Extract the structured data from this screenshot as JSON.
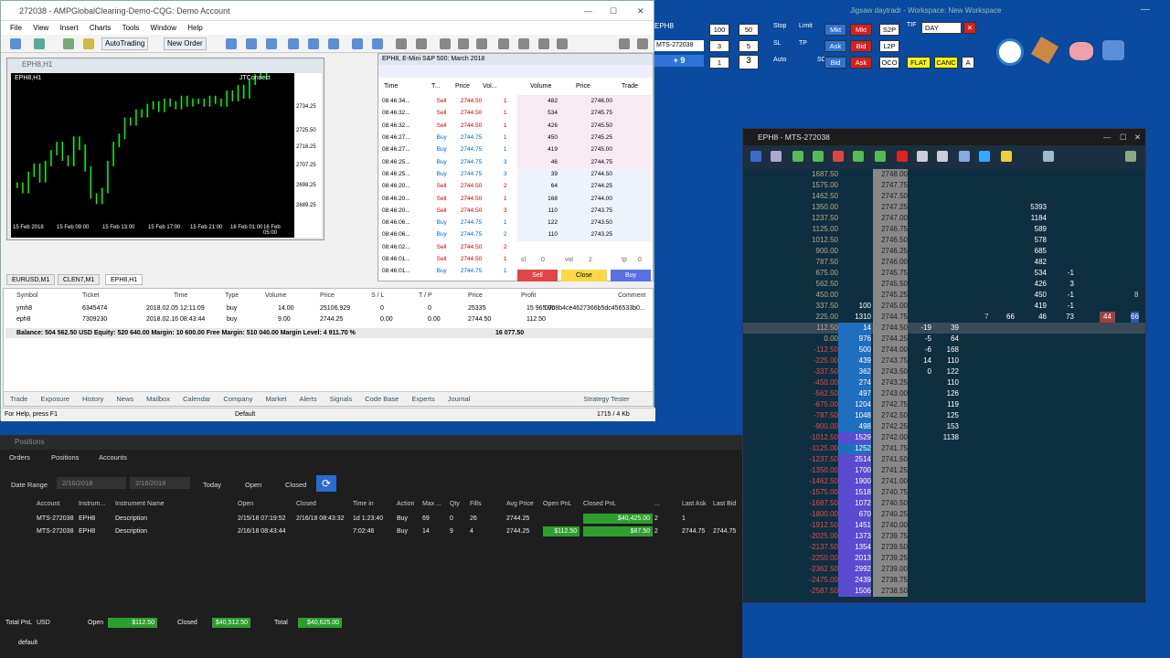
{
  "mt": {
    "title": "272038 - AMPGlobalClearing-Demo-CQG: Demo Account",
    "menu": [
      "File",
      "View",
      "Insert",
      "Charts",
      "Tools",
      "Window",
      "Help"
    ],
    "autotrading": "AutoTrading",
    "new_order": "New Order",
    "chart": {
      "title": "EPH8,H1",
      "symbol_label": "ЕРН8,Н1",
      "connector": "JTConnect",
      "y_ticks": [
        "2734.25",
        "2725.50",
        "2716.25",
        "2707.25",
        "2698.25",
        "2689.25"
      ],
      "x_ticks": [
        "15 Feb 2018",
        "15 Feb 09:00",
        "15 Feb 13:00",
        "15 Feb 17:00",
        "15 Feb 21:00",
        "16 Feb 01:00",
        "16 Feb 05:00"
      ]
    },
    "dom": {
      "title": "EPH8, E-Mini S&P 500: March 2018",
      "headers": [
        "Time",
        "T...",
        "Price",
        "Vol...",
        "Volume",
        "Price",
        "Trade"
      ],
      "ticks": [
        [
          "08:46:34...",
          "Sell",
          "2744.50",
          "1"
        ],
        [
          "08:46:32...",
          "Sell",
          "2744.50",
          "1"
        ],
        [
          "08:46:32...",
          "Sell",
          "2744.50",
          "1"
        ],
        [
          "08:46:27...",
          "Buy",
          "2744.75",
          "1"
        ],
        [
          "08:46:27...",
          "Buy",
          "2744.75",
          "1"
        ],
        [
          "08:46:25...",
          "Buy",
          "2744.75",
          "3"
        ],
        [
          "08:46:25...",
          "Buy",
          "2744.75",
          "3"
        ],
        [
          "08:46:20...",
          "Sell",
          "2744.50",
          "2"
        ],
        [
          "08:46:20...",
          "Sell",
          "2744.50",
          "1"
        ],
        [
          "08:46:20...",
          "Sell",
          "2744.50",
          "3"
        ],
        [
          "08:46:06...",
          "Buy",
          "2744.75",
          "1"
        ],
        [
          "08:46:06...",
          "Buy",
          "2744.75",
          "2"
        ],
        [
          "08:46:02...",
          "Sell",
          "2744.50",
          "2"
        ],
        [
          "08:46:01...",
          "Sell",
          "2744.50",
          "1"
        ],
        [
          "08:46:01...",
          "Buy",
          "2744.75",
          "1"
        ]
      ],
      "book": [
        [
          "482",
          "2746.00"
        ],
        [
          "534",
          "2745.75"
        ],
        [
          "426",
          "2745.50"
        ],
        [
          "450",
          "2745.25"
        ],
        [
          "419",
          "2745.00"
        ],
        [
          "46",
          "2744.75"
        ],
        [
          "39",
          "2744.50"
        ],
        [
          "64",
          "2744.25"
        ],
        [
          "168",
          "2744.00"
        ],
        [
          "110",
          "2743.75"
        ],
        [
          "122",
          "2743.50"
        ],
        [
          "110",
          "2743.25"
        ]
      ],
      "sl": "sl",
      "sl_val": "0",
      "vol": "vol",
      "vol_val": "2",
      "tp": "tp",
      "tp_val": "0",
      "sell": "Sell",
      "close": "Close",
      "buy": "Buy"
    },
    "symbol_tabs": [
      "EURUSD,M1",
      "CLEN7,M1",
      "EPH8,H1"
    ],
    "terminal": {
      "headers": [
        "Symbol",
        "Ticket",
        "Time",
        "Type",
        "Volume",
        "Price",
        "S / L",
        "T / P",
        "Price",
        "Profit",
        "Comment"
      ],
      "rows": [
        [
          "ymh8",
          "6345474",
          "2018.02.05 12:11:09",
          "buy",
          "14.00",
          "25106.929",
          "0",
          "0",
          "25335",
          "15 965.00",
          "07c8b4ce4627366b5dc456533b0..."
        ],
        [
          "eph8",
          "7309230",
          "2018.02.16 08:43:44",
          "buy",
          "9.00",
          "2744.25",
          "0.00",
          "0.00",
          "2744.50",
          "112.50",
          ""
        ]
      ],
      "balance": "Balance: 504 562.50 USD  Equity: 520 640.00  Margin: 10 600.00  Free Margin: 510 040.00  Margin Level: 4 911.70 %",
      "balance_profit": "16 077.50",
      "tabs": [
        "Trade",
        "Exposure",
        "History",
        "News",
        "Mailbox",
        "Calendar",
        "Company",
        "Market",
        "Alerts",
        "Signals",
        "Code Base",
        "Experts",
        "Journal"
      ],
      "strategy_tester": "Strategy Tester"
    },
    "status_left": "For Help, press F1",
    "status_mid": "Default",
    "status_right": "1715 / 4 Kb"
  },
  "positions": {
    "title": "Positions",
    "tabs": [
      "Orders",
      "Positions",
      "Accounts"
    ],
    "date_label": "Date Range",
    "date_from": "2/16/2018",
    "date_to": "2/16/2018",
    "today": "Today",
    "open": "Open",
    "closed": "Closed",
    "headers": [
      "Account",
      "Instrum...",
      "Instrument Name",
      "Open",
      "Closed",
      "Time in",
      "Action",
      "Max ...",
      "Qty",
      "Fills",
      "Avg Price",
      "Open PnL",
      "Closed PnL",
      "...",
      "Last Ask",
      "Last Bid"
    ],
    "rows": [
      [
        "MTS-272038",
        "EPH8",
        "Description",
        "2/15/18 07:19:52",
        "2/16/18 08:43:32",
        "1d 1:23:40",
        "Buy",
        "69",
        "0",
        "26",
        "2744.25",
        "",
        "$40,425.00",
        "2",
        "1",
        ""
      ],
      [
        "MTS-272038",
        "EPH8",
        "Description",
        "2/16/18 08:43:44",
        "",
        "7:02:46",
        "Buy",
        "14",
        "9",
        "4",
        "2744.25",
        "$112.50",
        "$87.50",
        "2",
        "2744.75",
        "2744.75"
      ]
    ],
    "footer": {
      "total_pnl": "Total PnL",
      "currency": "USD",
      "open_label": "Open",
      "open_val": "$112.50",
      "closed_label": "Closed",
      "closed_val": "$40,512.50",
      "total_label": "Total",
      "total_val": "$40,625.00"
    },
    "default": "default"
  },
  "topbar": {
    "symbol": "EPH8",
    "account": "MTS-272038",
    "position": "+ 9",
    "qty1": "100",
    "qty2": "50",
    "qty3": "3",
    "qty4": "5",
    "qty5": "1",
    "qty6": "3",
    "stop": "Stop",
    "limit": "Limit",
    "sl": "SL",
    "tp": "TP",
    "auto": "Auto",
    "so": "SO",
    "mkt": "Mkt",
    "s2p": "S2P",
    "tif": "TIF",
    "day": "DAY",
    "ask": "Ask",
    "bid": "Bid",
    "l2p": "L2P",
    "oco": "OCO",
    "flat": "FLAT",
    "canc": "CANC",
    "a": "A",
    "workspace": "Jigsaw daytradr - Workspace: New Workspace"
  },
  "ladder": {
    "title": "EPH8 - MTS-272038",
    "rows": [
      [
        "1687.50",
        "",
        "2748.00",
        "",
        "",
        "",
        ""
      ],
      [
        "1575.00",
        "",
        "2747.75",
        "",
        "",
        "",
        ""
      ],
      [
        "1462.50",
        "",
        "2747.50",
        "",
        "",
        "",
        ""
      ],
      [
        "1350.00",
        "",
        "2747.25",
        "",
        "",
        "5393",
        ""
      ],
      [
        "1237.50",
        "",
        "2747.00",
        "",
        "",
        "1184",
        ""
      ],
      [
        "1125.00",
        "",
        "2746.75",
        "",
        "",
        "589",
        ""
      ],
      [
        "1012.50",
        "",
        "2746.50",
        "",
        "",
        "578",
        ""
      ],
      [
        "900.00",
        "",
        "2746.25",
        "",
        "",
        "685",
        ""
      ],
      [
        "787.50",
        "",
        "2746.00",
        "",
        "",
        "482",
        ""
      ],
      [
        "675.00",
        "",
        "2745.75",
        "",
        "",
        "534",
        "-1"
      ],
      [
        "562.50",
        "",
        "2745.50",
        "",
        "",
        "426",
        "3"
      ],
      [
        "450.00",
        "",
        "2745.25",
        "",
        "",
        "450",
        "-1"
      ],
      [
        "337.50",
        "100",
        "2745.00",
        "",
        "",
        "419",
        "-1"
      ],
      [
        "225.00",
        "1310",
        "2744.75",
        "",
        "",
        "46",
        "73"
      ],
      [
        "112.50",
        "14",
        "2744.50",
        "-19",
        "39",
        "",
        ""
      ],
      [
        "0.00",
        "976",
        "2744.25",
        "-5",
        "64",
        "",
        ""
      ],
      [
        "-112.50",
        "500",
        "2744.00",
        "-6",
        "168",
        "",
        ""
      ],
      [
        "-225.00",
        "439",
        "2743.75",
        "14",
        "110",
        "",
        ""
      ],
      [
        "-337.50",
        "362",
        "2743.50",
        "0",
        "122",
        "",
        ""
      ],
      [
        "-450.00",
        "274",
        "2743.25",
        "",
        "110",
        "",
        ""
      ],
      [
        "-562.50",
        "497",
        "2743.00",
        "",
        "126",
        "",
        ""
      ],
      [
        "-675.00",
        "1204",
        "2742.75",
        "",
        "119",
        "",
        ""
      ],
      [
        "-787.50",
        "1048",
        "2742.50",
        "",
        "125",
        "",
        ""
      ],
      [
        "-900.00",
        "498",
        "2742.25",
        "",
        "153",
        "",
        ""
      ],
      [
        "-1012.50",
        "1529",
        "2742.00",
        "",
        "1138",
        "",
        ""
      ],
      [
        "-1125.00",
        "1252",
        "2741.75",
        "",
        "",
        "",
        ""
      ],
      [
        "-1237.50",
        "2514",
        "2741.50",
        "",
        "",
        "",
        ""
      ],
      [
        "-1350.00",
        "1700",
        "2741.25",
        "",
        "",
        "",
        ""
      ],
      [
        "-1462.50",
        "1900",
        "2741.00",
        "",
        "",
        "",
        ""
      ],
      [
        "-1575.00",
        "1518",
        "2740.75",
        "",
        "",
        "",
        ""
      ],
      [
        "-1687.50",
        "1072",
        "2740.50",
        "",
        "",
        "",
        ""
      ],
      [
        "-1800.00",
        "670",
        "2740.25",
        "",
        "",
        "",
        ""
      ],
      [
        "-1912.50",
        "1451",
        "2740.00",
        "",
        "",
        "",
        ""
      ],
      [
        "-2025.00",
        "1373",
        "2739.75",
        "",
        "",
        "",
        ""
      ],
      [
        "-2137.50",
        "1354",
        "2739.50",
        "",
        "",
        "",
        ""
      ],
      [
        "-2250.00",
        "2013",
        "2739.25",
        "",
        "",
        "",
        ""
      ],
      [
        "-2362.50",
        "2992",
        "2739.00",
        "",
        "",
        "",
        ""
      ],
      [
        "-2475.00",
        "2439",
        "2738.75",
        "",
        "",
        "",
        ""
      ],
      [
        "-2587.50",
        "1506",
        "2738.50",
        "",
        "",
        "",
        ""
      ]
    ],
    "side_vals": {
      "a": "7",
      "b": "66",
      "c": "44",
      "d": "66",
      "e": "8"
    }
  },
  "colors": {
    "accent": "#2a7ac8",
    "sell": "#d42020",
    "green": "#2e9e2e"
  }
}
